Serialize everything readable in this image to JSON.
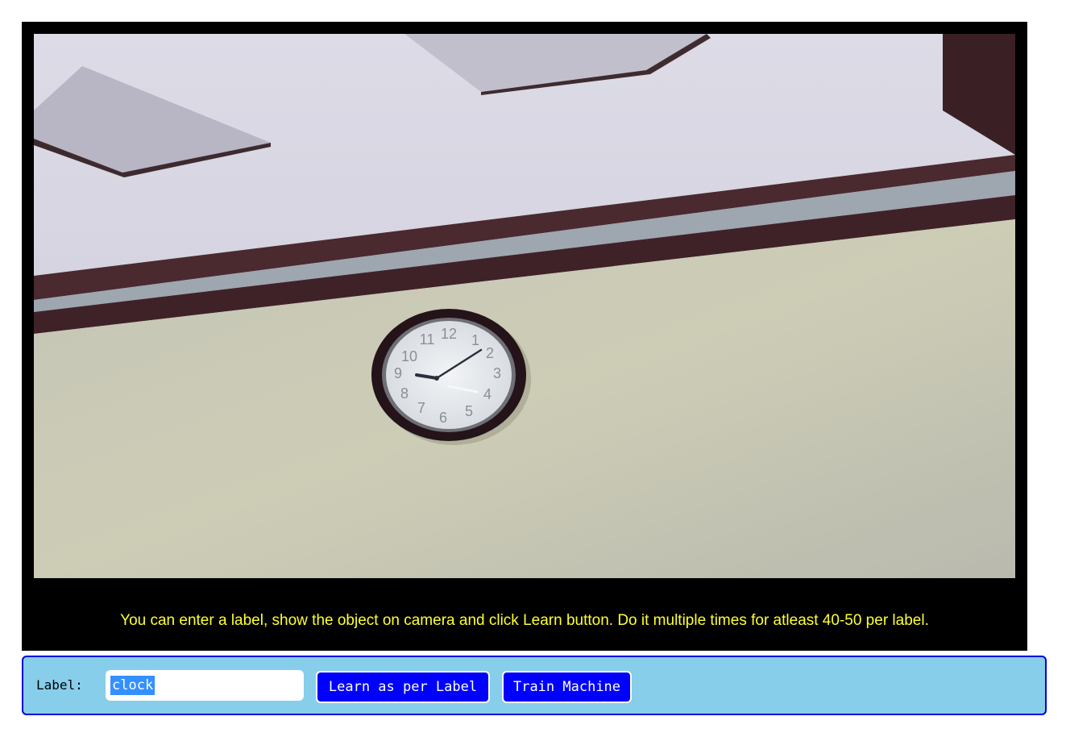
{
  "camera": {
    "feed_subject": "wall-clock",
    "instruction_text": "You can enter a label, show the object on camera and click Learn button. Do it multiple times for atleast 40-50 per label."
  },
  "controls": {
    "label_caption": "Label:",
    "label_value": "clock",
    "learn_button": "Learn as per Label",
    "train_button": "Train Machine"
  },
  "colors": {
    "instruction_text": "#ffff33",
    "controls_background": "#87ceeb",
    "controls_border": "#0000e0",
    "button_background": "#0000ff",
    "selection_highlight": "#3390ff"
  }
}
